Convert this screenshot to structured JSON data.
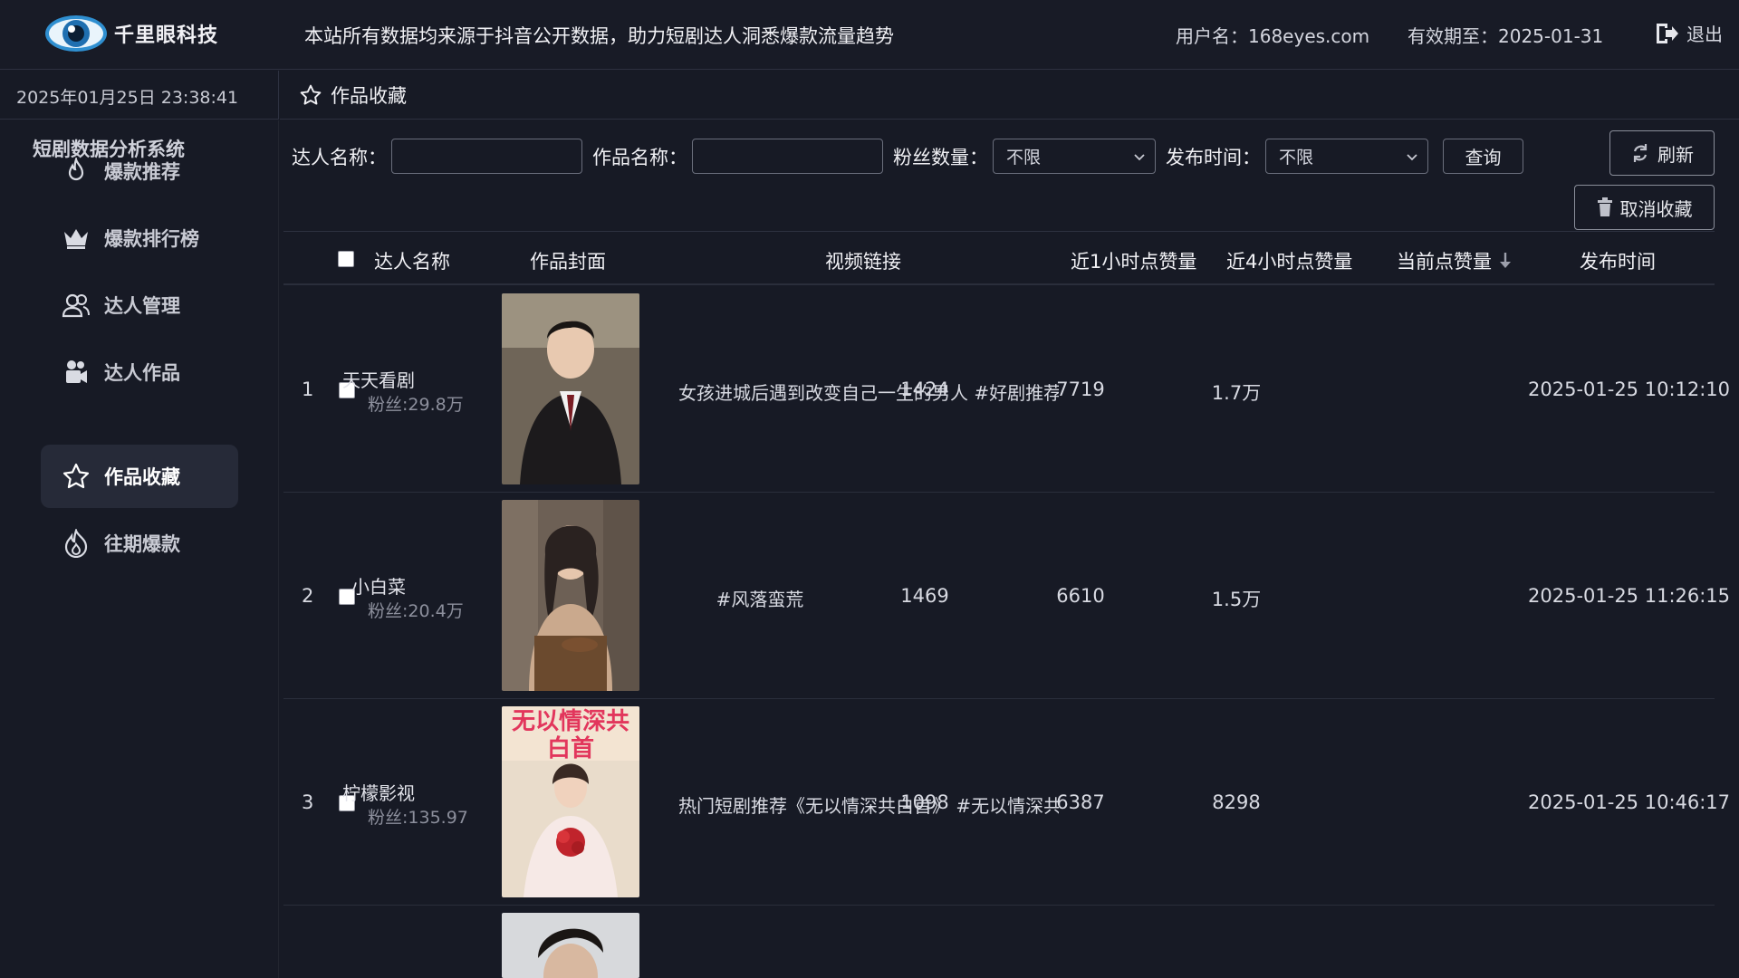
{
  "header": {
    "brand": "千里眼科技",
    "notice": "本站所有数据均来源于抖音公开数据，助力短剧达人洞悉爆款流量趋势",
    "user": "用户名：168eyes.com",
    "expire": "有效期至：2025-01-31",
    "logout": "退出"
  },
  "datetime": "2025年01月25日 23:38:41",
  "sidebar": {
    "title": "短剧数据分析系统",
    "items": [
      {
        "label": "爆款推荐",
        "icon": "flame-icon"
      },
      {
        "label": "爆款排行榜",
        "icon": "crown-icon"
      },
      {
        "label": "达人管理",
        "icon": "users-icon"
      },
      {
        "label": "达人作品",
        "icon": "video-camera-icon"
      },
      {
        "label": "作品收藏",
        "icon": "star-icon",
        "active": true
      },
      {
        "label": "往期爆款",
        "icon": "fire-outline-icon"
      }
    ]
  },
  "breadcrumb": "作品收藏",
  "filters": {
    "author_label": "达人名称：",
    "work_label": "作品名称：",
    "fans_label": "粉丝数量：",
    "fans_value": "不限",
    "publish_label": "发布时间：",
    "publish_value": "不限",
    "query": "查询",
    "refresh": "刷新",
    "unfavorite": "取消收藏"
  },
  "table": {
    "headers": {
      "author": "达人名称",
      "cover": "作品封面",
      "link": "视频链接",
      "likes_1h": "近1小时点赞量",
      "likes_4h": "近4小时点赞量",
      "likes_now": "当前点赞量",
      "publish_time": "发布时间"
    },
    "rows": [
      {
        "index": "1",
        "author": "天天看剧",
        "fans": "粉丝:29.8万",
        "link": "女孩进城后遇到改变自己一生的男人 #好剧推荐",
        "likes_1h": "1424",
        "likes_4h": "7719",
        "likes_now": "1.7万",
        "time": "2025-01-25 10:12:10"
      },
      {
        "index": "2",
        "author": "小白菜",
        "fans": "粉丝:20.4万",
        "link": "#风落蛮荒",
        "likes_1h": "1469",
        "likes_4h": "6610",
        "likes_now": "1.5万",
        "time": "2025-01-25 11:26:15"
      },
      {
        "index": "3",
        "author": "柠檬影视",
        "fans": "粉丝:135.97",
        "link": "热门短剧推荐《无以情深共白首》 #无以情深共",
        "likes_1h": "1098",
        "likes_4h": "6387",
        "likes_now": "8298",
        "time": "2025-01-25 10:46:17",
        "cover_text": "无以情深共白首"
      }
    ]
  },
  "colors": {
    "background": "#171a25",
    "active_nav": "#262a38",
    "border": "#2d3140"
  }
}
